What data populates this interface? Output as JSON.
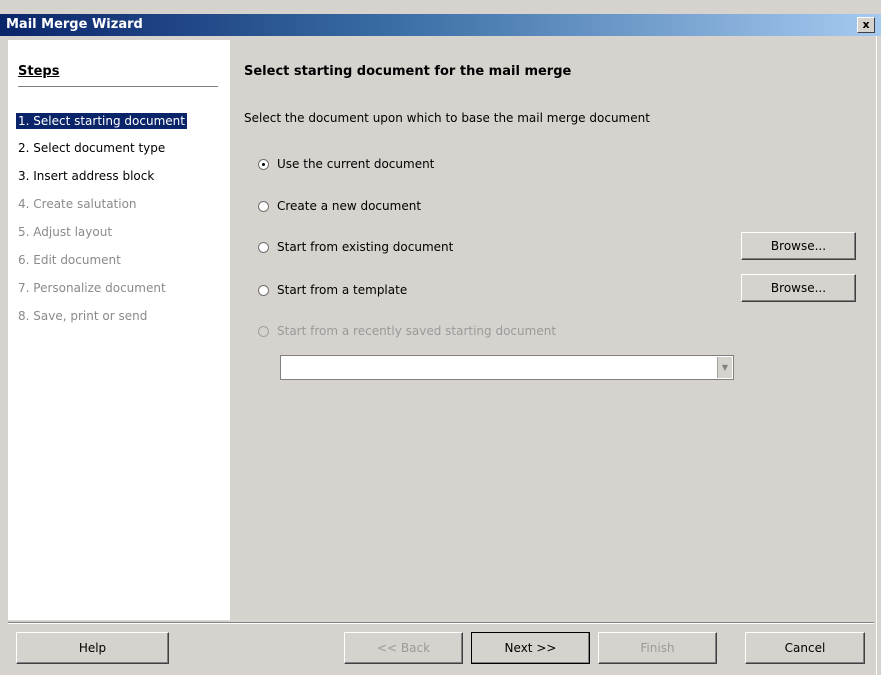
{
  "window": {
    "title": "Mail Merge Wizard",
    "close_label": "x"
  },
  "steps": {
    "heading": "Steps",
    "items": [
      {
        "label": "1. Select starting document",
        "state": "current"
      },
      {
        "label": "2. Select document type",
        "state": "done"
      },
      {
        "label": "3. Insert address block",
        "state": "done"
      },
      {
        "label": "4. Create salutation",
        "state": "disabled"
      },
      {
        "label": "5. Adjust layout",
        "state": "disabled"
      },
      {
        "label": "6. Edit document",
        "state": "disabled"
      },
      {
        "label": "7. Personalize document",
        "state": "disabled"
      },
      {
        "label": "8. Save, print or send",
        "state": "disabled"
      }
    ]
  },
  "main": {
    "title": "Select starting document for the mail merge",
    "description": "Select the document upon which to base the mail merge document",
    "options": [
      {
        "label": "Use the current document",
        "checked": true,
        "disabled": false
      },
      {
        "label": "Create a new document",
        "checked": false,
        "disabled": false
      },
      {
        "label": "Start from existing document",
        "checked": false,
        "disabled": false
      },
      {
        "label": "Start from a template",
        "checked": false,
        "disabled": false
      },
      {
        "label": "Start from a recently saved starting document",
        "checked": false,
        "disabled": true
      }
    ],
    "browse_label": "Browse...",
    "recent_value": ""
  },
  "footer": {
    "help": "Help",
    "back": "<< Back",
    "next": "Next >>",
    "finish": "Finish",
    "cancel": "Cancel"
  }
}
